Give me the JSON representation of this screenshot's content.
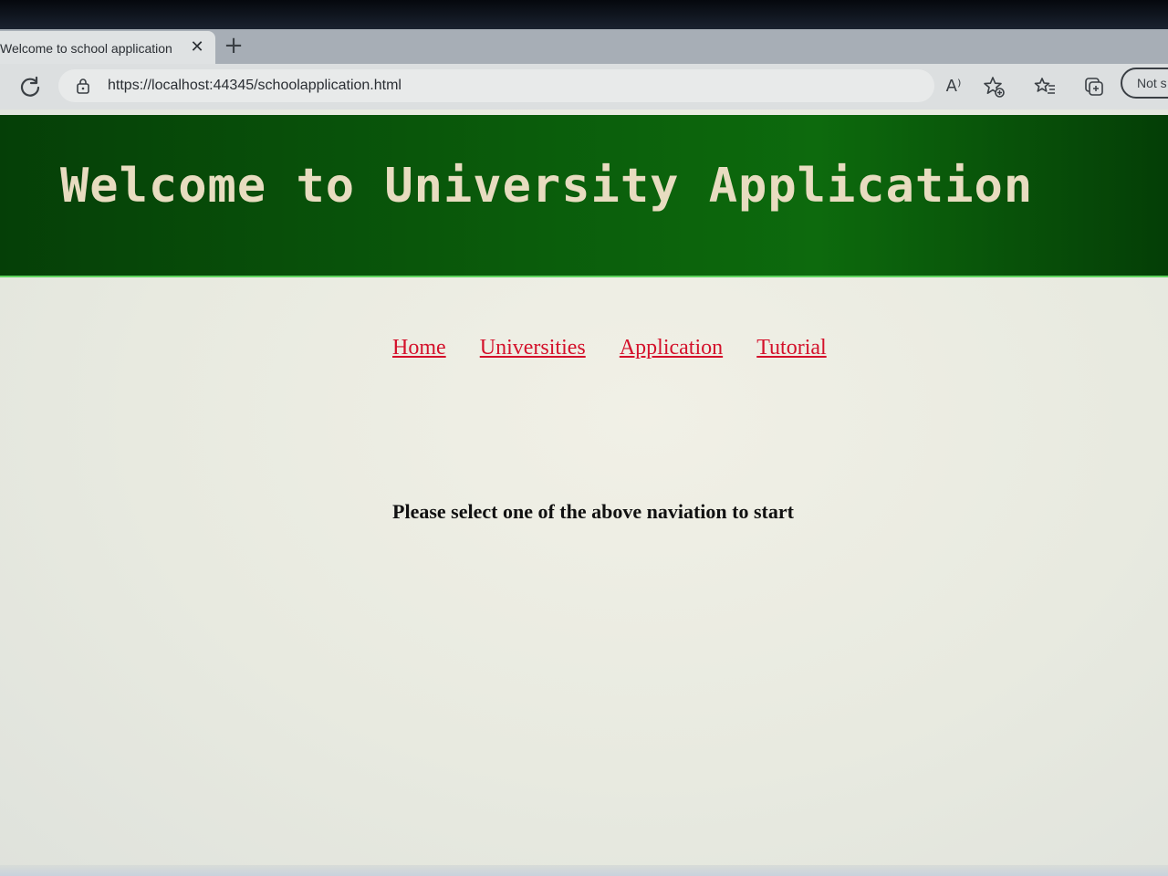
{
  "browser": {
    "tab": {
      "title": "Welcome to school application",
      "close_glyph": "✕",
      "new_tab_glyph": "+"
    },
    "address": {
      "url": "https://localhost:44345/schoolapplication.html"
    },
    "toolbar": {
      "read_aloud_glyph": "A⁾",
      "profile_label": "Not s"
    },
    "icons": [
      "refresh-icon",
      "lock-icon",
      "read-aloud-icon",
      "add-favorite-icon",
      "favorites-icon",
      "collections-icon"
    ]
  },
  "page": {
    "banner_title": "Welcome to University Application",
    "nav": [
      {
        "label": "Home"
      },
      {
        "label": "Universities"
      },
      {
        "label": "Application"
      },
      {
        "label": "Tutorial"
      }
    ],
    "instruction": "Please select one of the above naviation to start",
    "colors": {
      "banner_bg": "#0a5c0b",
      "banner_text": "#e8dcc0",
      "link": "#d4112b"
    }
  }
}
